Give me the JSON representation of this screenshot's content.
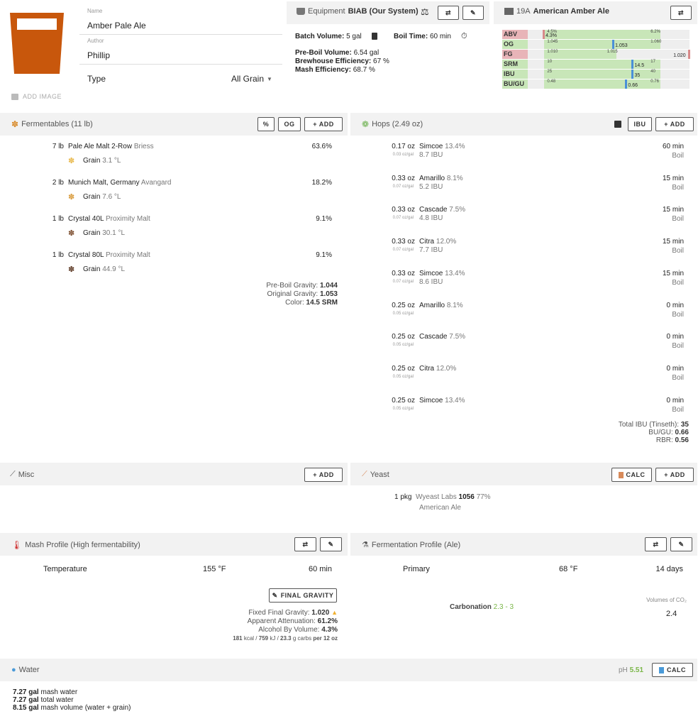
{
  "recipe": {
    "name_label": "Name",
    "name": "Amber Pale Ale",
    "author_label": "Author",
    "author": "Phillip",
    "type_label": "Type",
    "type": "All Grain",
    "add_image": "ADD IMAGE",
    "glass_color": "#c8570c"
  },
  "equipment": {
    "label": "Equipment",
    "name": "BIAB (Our System)",
    "batch_label": "Batch Volume:",
    "batch": "5 gal",
    "boil_label": "Boil Time:",
    "boil": "60 min",
    "preboil_label": "Pre-Boil Volume:",
    "preboil": "6.54 gal",
    "brewhouse_label": "Brewhouse Efficiency:",
    "brewhouse": "67 %",
    "mash_label": "Mash Efficiency:",
    "mash": "68.7 %"
  },
  "style": {
    "code": "19A",
    "name": "American Amber Ale",
    "rows": [
      {
        "label": "ABV",
        "low": "4.5%",
        "high": "6.2%",
        "value": "4.3%",
        "ok": false
      },
      {
        "label": "OG",
        "low": "1.045",
        "high": "1.060",
        "value": "1.053",
        "ok": true
      },
      {
        "label": "FG",
        "low": "1.010",
        "high": "1.015",
        "value": "1.020",
        "ok": false
      },
      {
        "label": "SRM",
        "low": "10",
        "high": "17",
        "value": "14.5",
        "ok": true
      },
      {
        "label": "IBU",
        "low": "25",
        "high": "40",
        "value": "35",
        "ok": true
      },
      {
        "label": "BU/GU",
        "low": "0.48",
        "high": "0.76",
        "value": "0.66",
        "ok": true
      }
    ]
  },
  "fermentables": {
    "title": "Fermentables (11 lb)",
    "btn_pct": "%",
    "btn_og": "OG",
    "btn_add": "+ ADD",
    "items": [
      {
        "amount": "7 lb",
        "name": "Pale Ale Malt 2-Row",
        "supplier": "Briess",
        "kind": "Grain",
        "color": "3.1 °L",
        "pct": "63.6%",
        "icon_color": "#e8b84a"
      },
      {
        "amount": "2 lb",
        "name": "Munich Malt, Germany",
        "supplier": "Avangard",
        "kind": "Grain",
        "color": "7.6 °L",
        "pct": "18.2%",
        "icon_color": "#d89a3a"
      },
      {
        "amount": "1 lb",
        "name": "Crystal 40L",
        "supplier": "Proximity Malt",
        "kind": "Grain",
        "color": "30.1 °L",
        "pct": "9.1%",
        "icon_color": "#7a4a2a"
      },
      {
        "amount": "1 lb",
        "name": "Crystal 80L",
        "supplier": "Proximity Malt",
        "kind": "Grain",
        "color": "44.9 °L",
        "pct": "9.1%",
        "icon_color": "#5a3520"
      }
    ],
    "preboil_label": "Pre-Boil Gravity:",
    "preboil": "1.044",
    "og_label": "Original Gravity:",
    "og": "1.053",
    "color_label": "Color:",
    "color": "14.5 SRM"
  },
  "hops": {
    "title": "Hops (2.49 oz)",
    "btn_ibu": "IBU",
    "btn_add": "+ ADD",
    "items": [
      {
        "amount": "0.17 oz",
        "rate": "0.03 oz/gal",
        "name": "Simcoe",
        "alpha": "13.4%",
        "ibu": "8.7 IBU",
        "time": "60 min",
        "use": "Boil"
      },
      {
        "amount": "0.33 oz",
        "rate": "0.07 oz/gal",
        "name": "Amarillo",
        "alpha": "8.1%",
        "ibu": "5.2 IBU",
        "time": "15 min",
        "use": "Boil"
      },
      {
        "amount": "0.33 oz",
        "rate": "0.07 oz/gal",
        "name": "Cascade",
        "alpha": "7.5%",
        "ibu": "4.8 IBU",
        "time": "15 min",
        "use": "Boil"
      },
      {
        "amount": "0.33 oz",
        "rate": "0.07 oz/gal",
        "name": "Citra",
        "alpha": "12.0%",
        "ibu": "7.7 IBU",
        "time": "15 min",
        "use": "Boil"
      },
      {
        "amount": "0.33 oz",
        "rate": "0.07 oz/gal",
        "name": "Simcoe",
        "alpha": "13.4%",
        "ibu": "8.6 IBU",
        "time": "15 min",
        "use": "Boil"
      },
      {
        "amount": "0.25 oz",
        "rate": "0.05 oz/gal",
        "name": "Amarillo",
        "alpha": "8.1%",
        "ibu": "",
        "time": "0 min",
        "use": "Boil"
      },
      {
        "amount": "0.25 oz",
        "rate": "0.05 oz/gal",
        "name": "Cascade",
        "alpha": "7.5%",
        "ibu": "",
        "time": "0 min",
        "use": "Boil"
      },
      {
        "amount": "0.25 oz",
        "rate": "0.05 oz/gal",
        "name": "Citra",
        "alpha": "12.0%",
        "ibu": "",
        "time": "0 min",
        "use": "Boil"
      },
      {
        "amount": "0.25 oz",
        "rate": "0.05 oz/gal",
        "name": "Simcoe",
        "alpha": "13.4%",
        "ibu": "",
        "time": "0 min",
        "use": "Boil"
      }
    ],
    "total_label": "Total IBU (Tinseth):",
    "total": "35",
    "bugu_label": "BU/GU:",
    "bugu": "0.66",
    "rbr_label": "RBR:",
    "rbr": "0.56"
  },
  "misc": {
    "title": "Misc",
    "btn_add": "+ ADD"
  },
  "yeast": {
    "title": "Yeast",
    "btn_calc": "CALC",
    "btn_add": "+ ADD",
    "amount": "1 pkg",
    "lab": "Wyeast Labs",
    "code": "1056",
    "atten": "77%",
    "name": "American Ale"
  },
  "mash": {
    "title": "Mash Profile (High fermentability)",
    "step": "Temperature",
    "temp": "155 °F",
    "time": "60 min",
    "btn_fg": "FINAL GRAVITY",
    "fg_label": "Fixed Final Gravity:",
    "fg": "1.020",
    "aa_label": "Apparent Attenuation:",
    "aa": "61.2%",
    "abv_label": "Alcohol By Volume:",
    "abv": "4.3%",
    "kcal": "181",
    "kcal_u": "kcal /",
    "kj": "759",
    "kj_u": "kJ /",
    "carbs": "23.3",
    "carbs_u": "g carbs",
    "per": "per 12 oz"
  },
  "fermentation": {
    "title": "Fermentation Profile (Ale)",
    "step": "Primary",
    "temp": "68 °F",
    "time": "14 days",
    "carb_label": "Carbonation",
    "carb_range": "2.3 - 3",
    "vol_label": "Volumes of CO₂",
    "vol": "2.4"
  },
  "water": {
    "title": "Water",
    "ph_label": "pH",
    "ph": "5.51",
    "btn_calc": "CALC",
    "mash_water": "7.27 gal",
    "mash_water_l": "mash water",
    "total_water": "7.27 gal",
    "total_water_l": "total water",
    "mash_vol": "8.15 gal",
    "mash_vol_l": "mash volume (water + grain)"
  }
}
